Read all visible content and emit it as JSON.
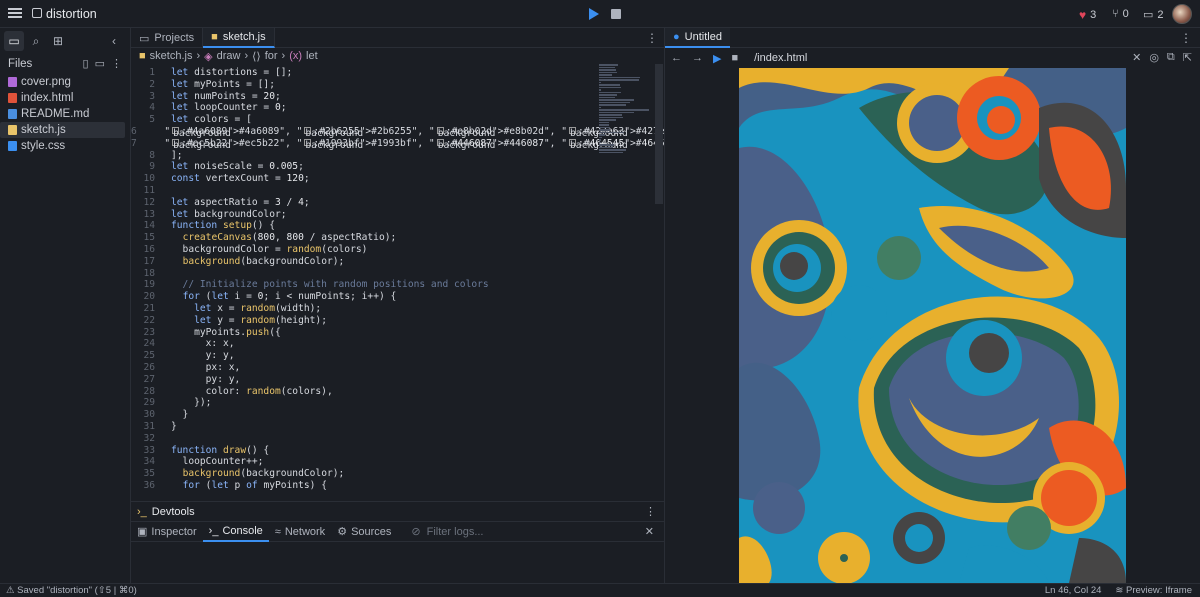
{
  "app": {
    "project_name": "distortion"
  },
  "topbar": {
    "likes": "3",
    "forks": "0",
    "comments": "2"
  },
  "sidebar": {
    "files_label": "Files",
    "files": [
      {
        "name": "cover.png",
        "icon": "image-icon",
        "color": "#b06ad8"
      },
      {
        "name": "index.html",
        "icon": "html-icon",
        "color": "#e0533a"
      },
      {
        "name": "README.md",
        "icon": "markdown-icon",
        "color": "#4a8fe0"
      },
      {
        "name": "sketch.js",
        "icon": "js-icon",
        "color": "#e9c46a"
      },
      {
        "name": "style.css",
        "icon": "css-icon",
        "color": "#3b8ff0"
      }
    ]
  },
  "editor": {
    "tabs": [
      {
        "label": "Projects"
      },
      {
        "label": "sketch.js"
      }
    ],
    "breadcrumb": [
      "sketch.js",
      "draw",
      "for",
      "let"
    ],
    "lines": [
      "let distortions = [];",
      "let myPoints = [];",
      "let numPoints = 20;",
      "let loopCounter = 0;",
      "let colors = [",
      "  \"#4a6089\", \"#2b6255\", \"#e8b02d\", \"#427e63\",",
      "  \"#ec5b22\", \"#1993bf\", \"#446087\", \"#464545\"",
      "];",
      "let noiseScale = 0.005;",
      "const vertexCount = 120;",
      "",
      "let aspectRatio = 3 / 4;",
      "let backgroundColor;",
      "function setup() {",
      "  createCanvas(800, 800 / aspectRatio);",
      "  backgroundColor = random(colors)",
      "  background(backgroundColor);",
      "",
      "  // Initialize points with random positions and colors",
      "  for (let i = 0; i < numPoints; i++) {",
      "    let x = random(width);",
      "    let y = random(height);",
      "    myPoints.push({",
      "      x: x,",
      "      y: y,",
      "      px: x,",
      "      py: y,",
      "      color: random(colors),",
      "    });",
      "  }",
      "}",
      "",
      "function draw() {",
      "  loopCounter++;",
      "  background(backgroundColor);",
      "  for (let p of myPoints) {"
    ]
  },
  "devtools": {
    "title": "Devtools",
    "tabs": [
      "Inspector",
      "Console",
      "Network",
      "Sources"
    ],
    "filter_placeholder": "Filter logs..."
  },
  "preview": {
    "tab_label": "Untitled",
    "url": "/index.html"
  },
  "statusbar": {
    "saved": "Saved \"distortion\" (⇧5 | ⌘0)",
    "position": "Ln 46, Col 24",
    "preview_mode": "Preview: Iframe"
  },
  "palette": [
    "#4a6089",
    "#2b6255",
    "#e8b02d",
    "#427e63",
    "#ec5b22",
    "#1993bf",
    "#446087",
    "#464545"
  ]
}
